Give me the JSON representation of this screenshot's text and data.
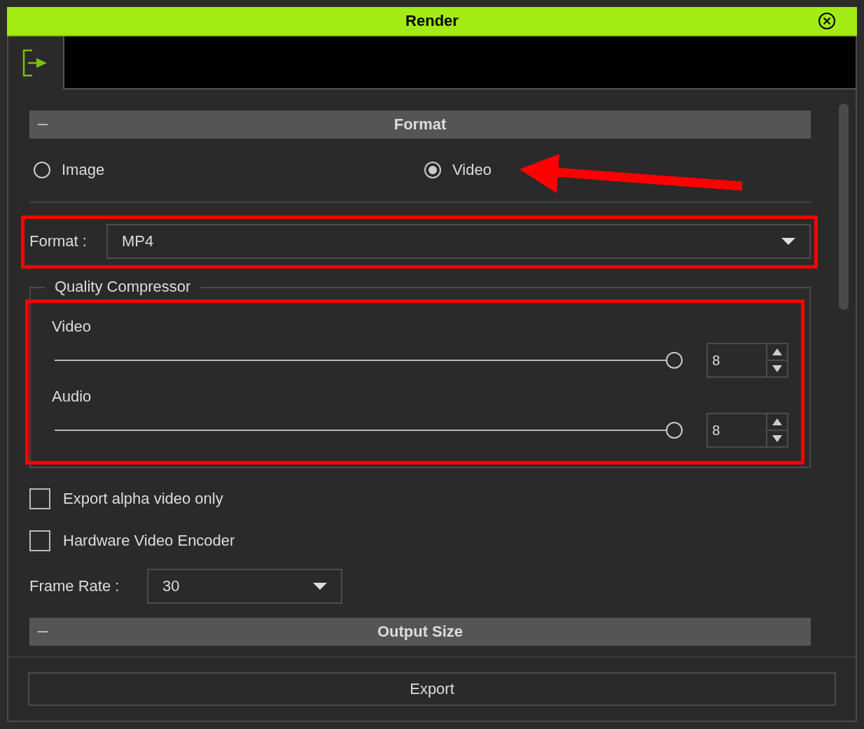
{
  "window": {
    "title": "Render"
  },
  "format_section": {
    "title": "Format",
    "expanded": true,
    "output_types": [
      {
        "label": "Image",
        "selected": false
      },
      {
        "label": "Video",
        "selected": true
      }
    ],
    "format": {
      "label": "Format :",
      "value": "MP4"
    },
    "quality": {
      "title": "Quality Compressor",
      "channels": [
        {
          "name": "Video",
          "level": 1,
          "value": "8"
        },
        {
          "name": "Audio",
          "level": 1,
          "value": "8"
        }
      ]
    },
    "options": [
      {
        "label": "Export alpha video only",
        "checked": false
      },
      {
        "label": "Hardware Video Encoder",
        "checked": false
      }
    ],
    "frame_rate": {
      "label": "Frame Rate :",
      "value": "30"
    }
  },
  "output_size_section": {
    "title": "Output Size",
    "expanded": true
  },
  "export_button": "Export"
}
